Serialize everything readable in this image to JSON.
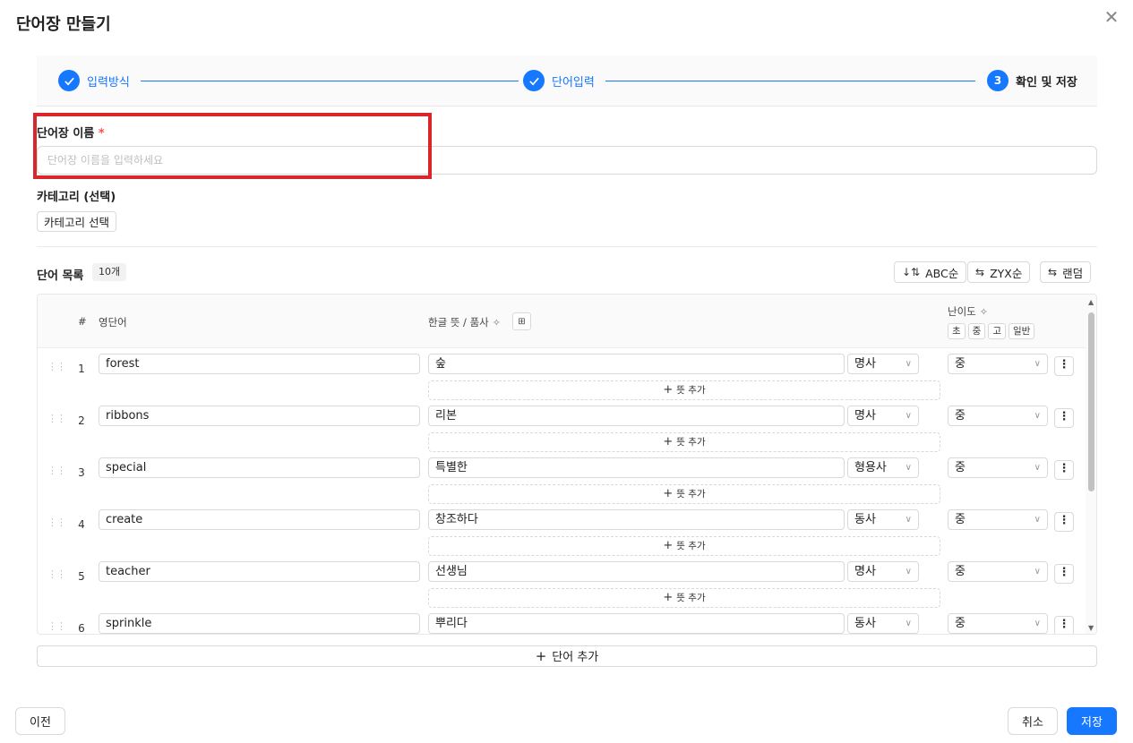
{
  "dialog": {
    "title": "단어장 만들기"
  },
  "steps": [
    {
      "label": "입력방식",
      "number": ""
    },
    {
      "label": "단어입력",
      "number": ""
    },
    {
      "label": "확인 및 저장",
      "number": "3"
    }
  ],
  "name_field": {
    "label": "단어장 이름",
    "required_mark": "*",
    "placeholder": "단어장 이름을 입력하세요",
    "value": ""
  },
  "category": {
    "label": "카테고리 (선택)",
    "button_label": "카테고리 선택"
  },
  "word_list": {
    "label": "단어 목록",
    "count_badge": "10개",
    "sort_buttons": [
      {
        "icon": "sort-az-icon",
        "label": "ABC순"
      },
      {
        "icon": "swap-icon",
        "label": "ZYX순"
      },
      {
        "icon": "shuffle-icon",
        "label": "랜덤"
      }
    ]
  },
  "table": {
    "headers": {
      "index": "#",
      "word": "영단어",
      "meaning": "한글 뜻 / 품사",
      "difficulty": "난이도"
    },
    "difficulty_buttons": [
      "초",
      "중",
      "고",
      "일반"
    ],
    "add_meaning_label": "뜻 추가",
    "rows": [
      {
        "num": "1",
        "word": "forest",
        "meaning": "숲",
        "pos": "명사",
        "level": "중"
      },
      {
        "num": "2",
        "word": "ribbons",
        "meaning": "리본",
        "pos": "명사",
        "level": "중"
      },
      {
        "num": "3",
        "word": "special",
        "meaning": "특별한",
        "pos": "형용사",
        "level": "중"
      },
      {
        "num": "4",
        "word": "create",
        "meaning": "창조하다",
        "pos": "동사",
        "level": "중"
      },
      {
        "num": "5",
        "word": "teacher",
        "meaning": "선생님",
        "pos": "명사",
        "level": "중"
      },
      {
        "num": "6",
        "word": "sprinkle",
        "meaning": "뿌리다",
        "pos": "동사",
        "level": "중"
      }
    ]
  },
  "add_word_label": "단어 추가",
  "footer": {
    "prev_label": "이전",
    "cancel_label": "취소",
    "save_label": "저장"
  },
  "colors": {
    "primary": "#1677ff",
    "highlight": "#d9262c",
    "required": "#ff4d4f"
  }
}
